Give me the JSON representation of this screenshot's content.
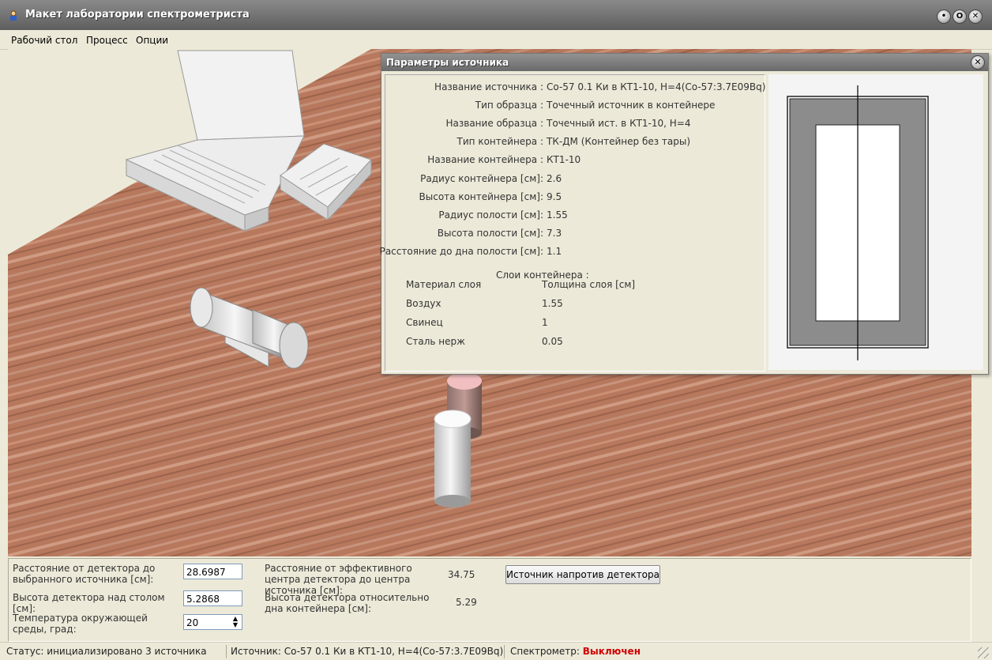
{
  "window": {
    "title": "Макет лаборатории спектрометриста",
    "buttons": [
      "•",
      "O",
      "✕"
    ]
  },
  "menu": [
    "Рабочий стол",
    "Процесс",
    "Опции"
  ],
  "source_panel": {
    "title": "Параметры источника",
    "params": [
      {
        "label": "Название источника :",
        "value": "Co-57 0.1 Ки в КТ1-10, H=4(Co-57:3.7E09Bq)"
      },
      {
        "label": "Тип образца :",
        "value": "Точечный источник в контейнере"
      },
      {
        "label": "Название образца :",
        "value": "Точечный ист. в КТ1-10, H=4"
      },
      {
        "label": "Тип контейнера :",
        "value": "ТК-ДМ (Контейнер без тары)"
      },
      {
        "label": "Название контейнера :",
        "value": "КТ1-10"
      },
      {
        "label": "Радиус контейнера [см]:",
        "value": "2.6"
      },
      {
        "label": "Высота контейнера [см]:",
        "value": "9.5"
      },
      {
        "label": "Радиус полости [см]:",
        "value": "1.55"
      },
      {
        "label": "Высота полости [см]:",
        "value": "7.3"
      },
      {
        "label": "Расстояние до дна полости [см]:",
        "value": "1.1"
      }
    ],
    "layers_title": "Слои контейнера :",
    "layers_header": {
      "material": "Материал слоя",
      "thickness": "Толщина слоя [см]"
    },
    "layers": [
      {
        "material": "Воздух",
        "thickness": "1.55"
      },
      {
        "material": "Свинец",
        "thickness": "1"
      },
      {
        "material": "Сталь нерж",
        "thickness": "0.05"
      }
    ]
  },
  "controls": {
    "distance_label": "Расстояние от детектора до выбранного источника [см]:",
    "distance_value": "28.6987",
    "height_label": "Высота детектора над столом [см]:",
    "height_value": "5.2868",
    "temp_label": "Температура окружающей среды, град:",
    "temp_value": "20",
    "eff_center_label": "Расстояние от эффективного центра детектора до центра источника [см]:",
    "eff_center_value": "34.75",
    "rel_height_label": "Высота детектора относительно дна контейнера [см]:",
    "rel_height_value": "5.29",
    "align_button": "Источник напротив детектора"
  },
  "status": {
    "status_text": "Статус: инициализировано 3 источника",
    "source_text": "Источник: Co-57 0.1 Ки в КТ1-10, H=4(Co-57:3.7E09Bq)",
    "spectrometer_label": "Спектрометр:",
    "spectrometer_state": "Выключен"
  }
}
